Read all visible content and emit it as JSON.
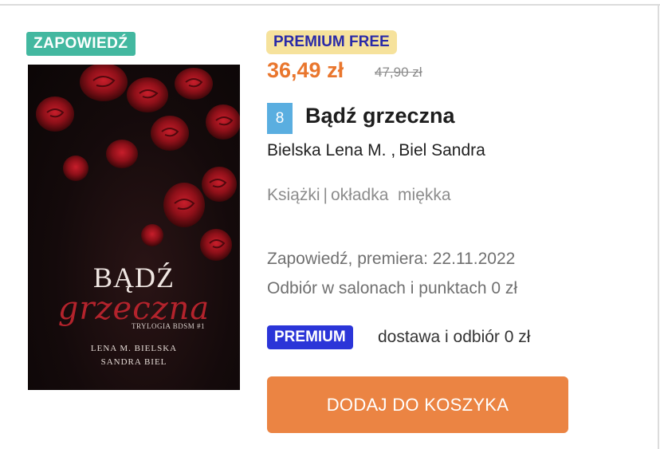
{
  "product": {
    "tag": "ZAPOWIEDŹ",
    "promo_badge": "PREMIUM FREE",
    "price": "36,49 zł",
    "old_price": "47,90 zł",
    "rank": "8",
    "title": "Bądź grzeczna",
    "authors": [
      "Bielska Lena M.",
      "Biel Sandra"
    ],
    "author_separator": ",",
    "category": "Książki",
    "format_separator": "|",
    "format": "okładka  miękka",
    "release_info": "Zapowiedź, premiera: 22.11.2022",
    "pickup_info": "Odbiór w salonach i punktach 0 zł",
    "premium_badge": "PREMIUM",
    "premium_delivery": "dostawa i odbiór 0 zł",
    "add_to_cart": "DODAJ DO KOSZYKA"
  },
  "cover": {
    "title": "BĄDŹ",
    "subtitle": "grzeczna",
    "series": "TRYLOGIA BDSM #1",
    "author_1": "LENA M. BIELSKA",
    "author_2": "SANDRA BIEL"
  },
  "colors": {
    "tag_bg": "#43b8a0",
    "promo_bg": "#f6e29c",
    "promo_text": "#2a2aa8",
    "price": "#e9762d",
    "rank_bg": "#5aaee0",
    "premium_bg": "#2b35d8",
    "cart_button": "#eb8443"
  }
}
